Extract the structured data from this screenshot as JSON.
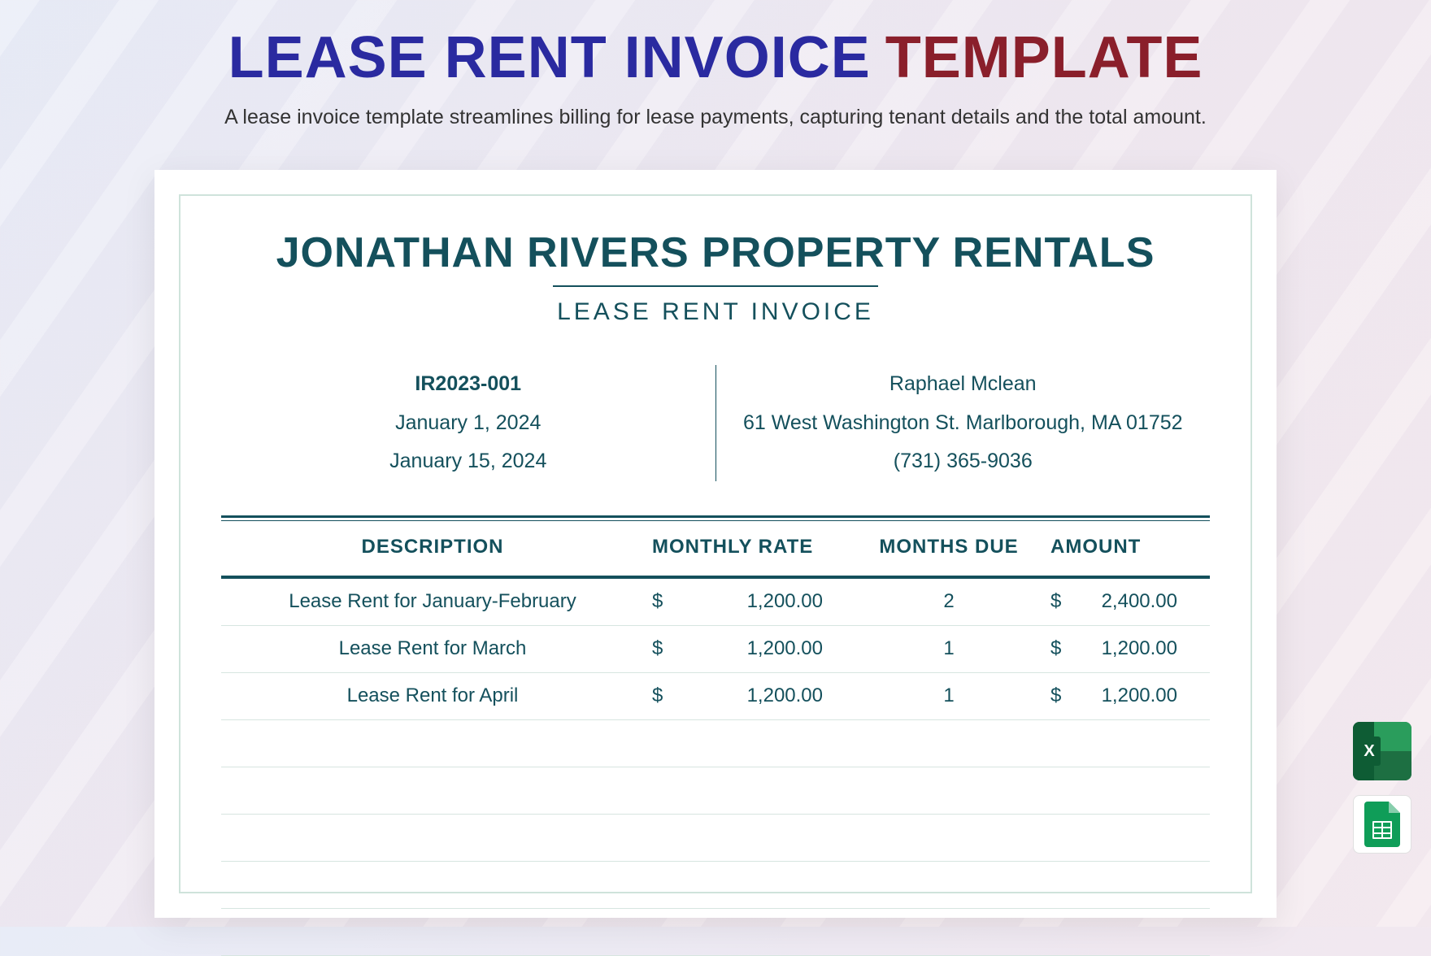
{
  "header": {
    "title_main": "LEASE RENT INVOICE",
    "title_accent": "TEMPLATE",
    "subtitle": "A lease invoice template streamlines billing for lease payments, capturing tenant details and the total amount."
  },
  "document": {
    "company_name": "JONATHAN RIVERS PROPERTY RENTALS",
    "doc_type": "LEASE RENT INVOICE",
    "meta_left": {
      "invoice_no": "IR2023-001",
      "date1": "January 1, 2024",
      "date2": "January 15, 2024"
    },
    "meta_right": {
      "name": "Raphael Mclean",
      "address": "61 West Washington St. Marlborough, MA 01752",
      "phone": "(731) 365-9036"
    },
    "columns": {
      "description": "DESCRIPTION",
      "rate": "MONTHLY RATE",
      "months": "MONTHS DUE",
      "amount": "AMOUNT"
    },
    "rows": [
      {
        "description": "Lease Rent for January-February",
        "rate": "1,200.00",
        "months": "2",
        "amount": "2,400.00"
      },
      {
        "description": "Lease Rent for March",
        "rate": "1,200.00",
        "months": "1",
        "amount": "1,200.00"
      },
      {
        "description": "Lease Rent for April",
        "rate": "1,200.00",
        "months": "1",
        "amount": "1,200.00"
      }
    ],
    "empty_row_count": 5,
    "currency_symbol": "$"
  },
  "side_icons": {
    "excel": "excel-icon",
    "sheets": "google-sheets-icon"
  }
}
